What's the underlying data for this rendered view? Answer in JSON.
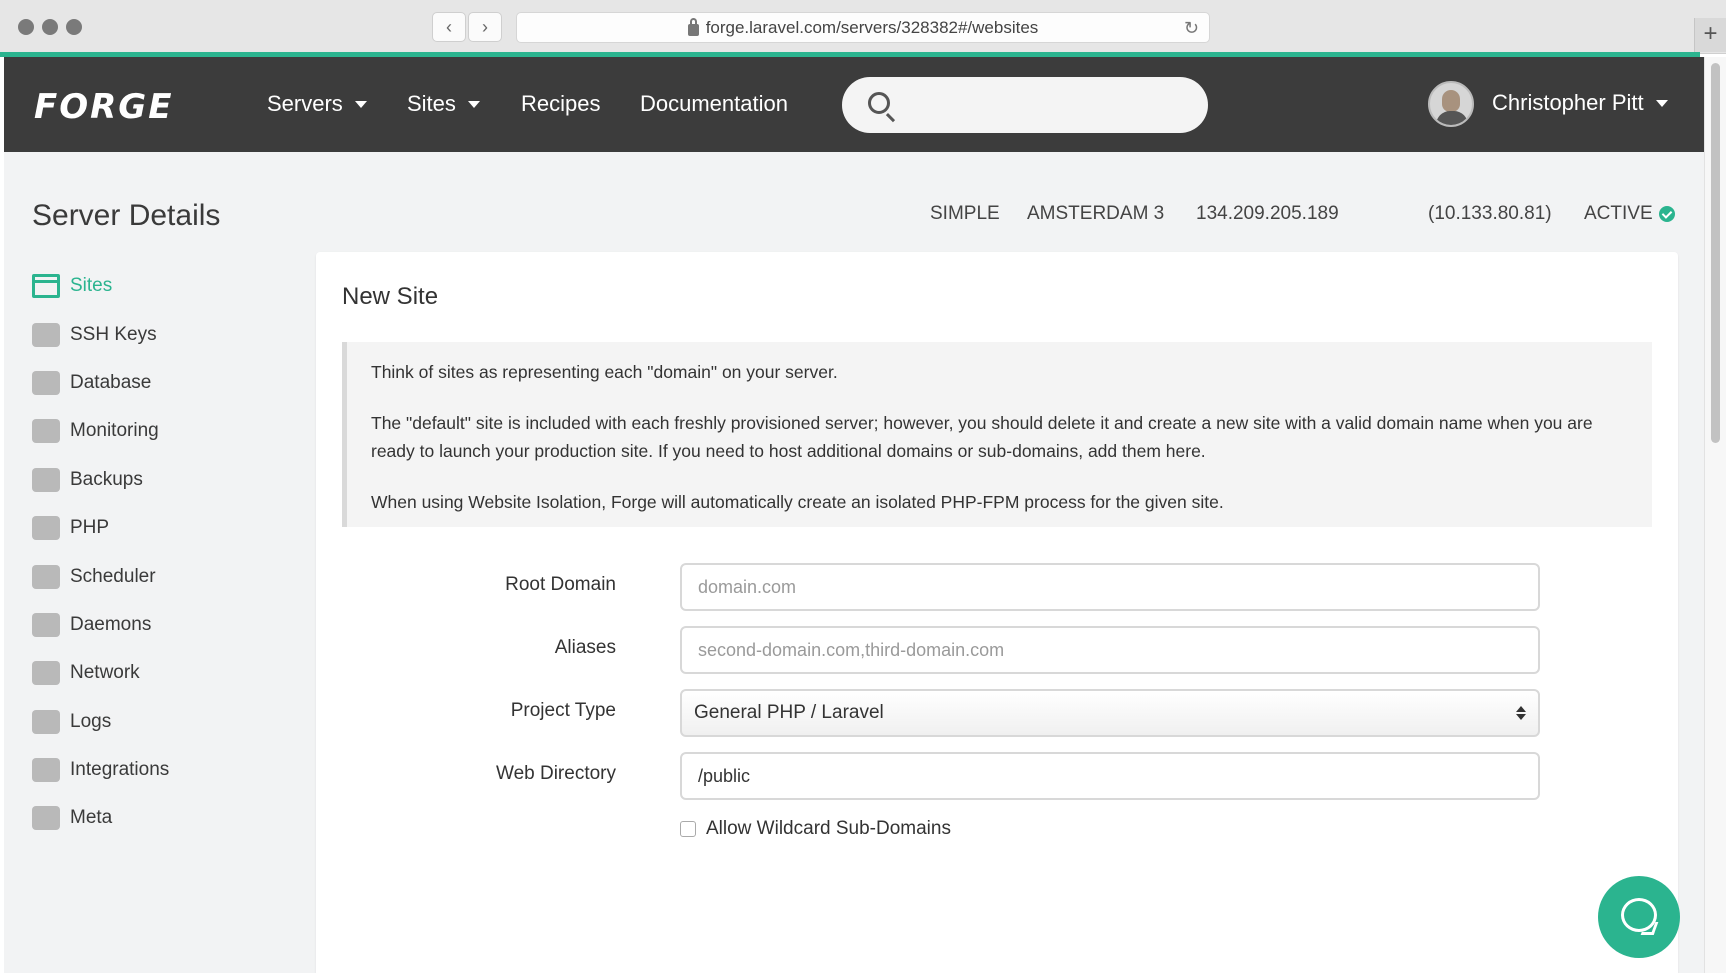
{
  "browser": {
    "url": "forge.laravel.com/servers/328382#/websites",
    "back_icon": "‹",
    "forward_icon": "›",
    "reload_icon": "↻",
    "new_tab_icon": "+"
  },
  "topnav": {
    "logo": "FORGE",
    "links": [
      "Servers",
      "Sites",
      "Recipes",
      "Documentation"
    ],
    "search_placeholder": "",
    "user_name": "Christopher Pitt"
  },
  "server": {
    "title": "Server Details",
    "plan": "SIMPLE",
    "region": "AMSTERDAM 3",
    "public_ip": "134.209.205.189",
    "private_ip": "(10.133.80.81)",
    "status": "ACTIVE"
  },
  "sidebar": {
    "items": [
      {
        "label": "Sites",
        "icon": "browser-window-icon"
      },
      {
        "label": "SSH Keys",
        "icon": "key-icon"
      },
      {
        "label": "Database",
        "icon": "database-icon"
      },
      {
        "label": "Monitoring",
        "icon": "chart-icon"
      },
      {
        "label": "Backups",
        "icon": "layers-icon"
      },
      {
        "label": "PHP",
        "icon": "elephant-icon"
      },
      {
        "label": "Scheduler",
        "icon": "calendar-icon"
      },
      {
        "label": "Daemons",
        "icon": "bolt-icon"
      },
      {
        "label": "Network",
        "icon": "globe-icon"
      },
      {
        "label": "Logs",
        "icon": "log-icon"
      },
      {
        "label": "Integrations",
        "icon": "plug-icon"
      },
      {
        "label": "Meta",
        "icon": "tag-icon"
      }
    ]
  },
  "card": {
    "title": "New Site",
    "info": [
      "Think of sites as representing each \"domain\" on your server.",
      "The \"default\" site is included with each freshly provisioned server; however, you should delete it and create a new site with a valid domain name when you are ready to launch your production site. If you need to host additional domains or sub-domains, add them here.",
      "When using Website Isolation, Forge will automatically create an isolated PHP-FPM process for the given site."
    ]
  },
  "form": {
    "root_domain_label": "Root Domain",
    "root_domain_placeholder": "domain.com",
    "root_domain_value": "",
    "aliases_label": "Aliases",
    "aliases_placeholder": "second-domain.com,third-domain.com",
    "aliases_value": "",
    "project_type_label": "Project Type",
    "project_type_value": "General PHP / Laravel",
    "web_directory_label": "Web Directory",
    "web_directory_value": "/public",
    "wildcard_label": "Allow Wildcard Sub-Domains"
  },
  "colors": {
    "accent": "#2bb48f",
    "nav_bg": "#3c3c3c",
    "page_bg": "#f2f3f4"
  }
}
